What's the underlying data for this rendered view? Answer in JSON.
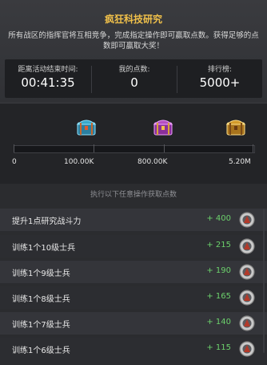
{
  "header": {
    "title": "疯狂科技研究",
    "description": "所有战区的指挥官将互相竞争，完成指定操作即可赢取点数。获得足够的点数即可赢取大奖！"
  },
  "stats": {
    "time_label": "距离活动结束时间:",
    "time_value": "00:41:35",
    "points_label": "我的点数:",
    "points_value": "0",
    "rank_label": "排行榜:",
    "rank_value": "5000+"
  },
  "rewards": {
    "progress_fraction": 0,
    "milestones": [
      {
        "label": "0",
        "chest": "none-icon"
      },
      {
        "label": "100.00K",
        "chest": "blue-chest-icon"
      },
      {
        "label": "800.00K",
        "chest": "purple-chest-icon"
      },
      {
        "label": "5.20M",
        "chest": "gold-chest-icon"
      }
    ]
  },
  "tasks_subtitle": "执行以下任意操作获取点数",
  "tasks": [
    {
      "name": "提升1点研究战斗力",
      "points": "+ 400"
    },
    {
      "name": "训练1个10级士兵",
      "points": "+ 215"
    },
    {
      "name": "训练1个9级士兵",
      "points": "+ 190"
    },
    {
      "name": "训练1个8级士兵",
      "points": "+ 165"
    },
    {
      "name": "训练1个7级士兵",
      "points": "+ 140"
    },
    {
      "name": "训练1个6级士兵",
      "points": "+ 115"
    }
  ],
  "colors": {
    "title": "#f0c04a",
    "points_green": "#6cd16c",
    "chest_blue": "#3aa7c8",
    "chest_purple": "#b34fc0",
    "chest_gold": "#d29a2a"
  }
}
